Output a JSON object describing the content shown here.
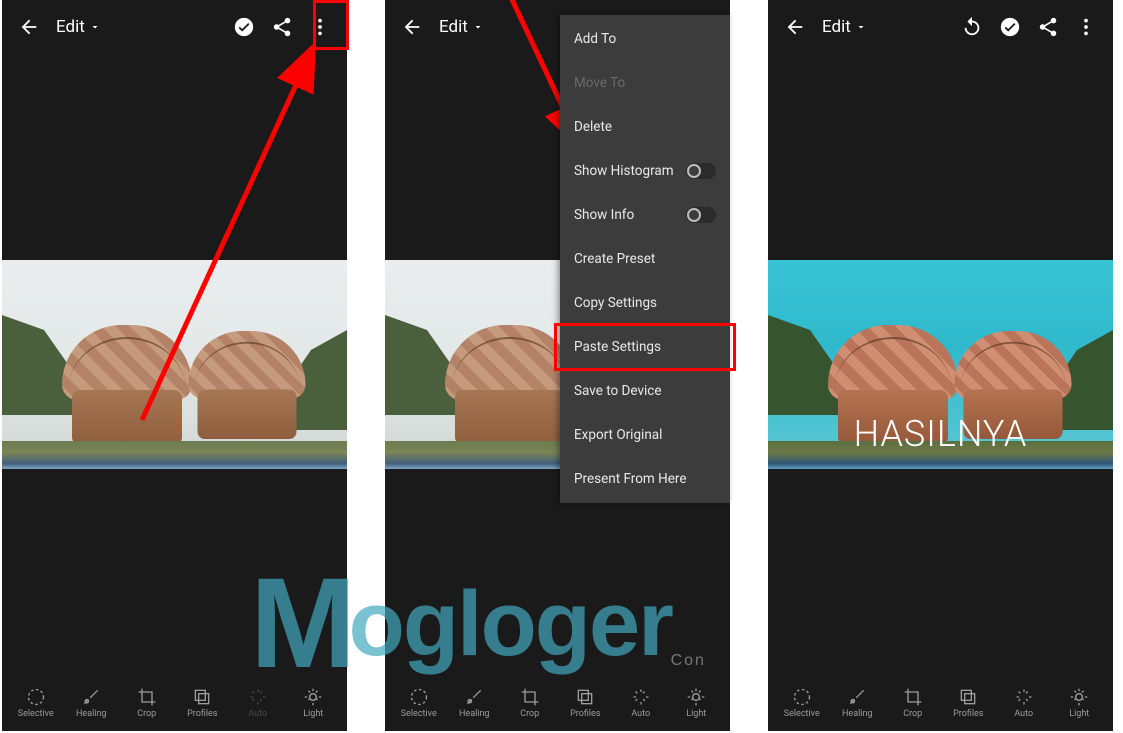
{
  "header": {
    "edit_label": "Edit"
  },
  "menu": {
    "add_to": "Add To",
    "move_to": "Move To",
    "delete": "Delete",
    "show_histogram": "Show Histogram",
    "show_info": "Show Info",
    "create_preset": "Create Preset",
    "copy_settings": "Copy Settings",
    "paste_settings": "Paste Settings",
    "save_to_device": "Save to Device",
    "export_original": "Export Original",
    "present_from_here": "Present From Here",
    "show_histogram_on": false,
    "show_info_on": false
  },
  "tools": {
    "selective": "Selective",
    "healing": "Healing",
    "crop": "Crop",
    "profiles": "Profiles",
    "auto": "Auto",
    "light": "Light"
  },
  "panel3": {
    "result_label": "HASILNYA"
  },
  "watermark": {
    "text": "ogloger",
    "prefix": "M",
    "sub": "Con"
  },
  "colors": {
    "highlight": "#ff0000",
    "menu_bg": "#3c3c3c",
    "app_bg": "#1a1a1a"
  }
}
